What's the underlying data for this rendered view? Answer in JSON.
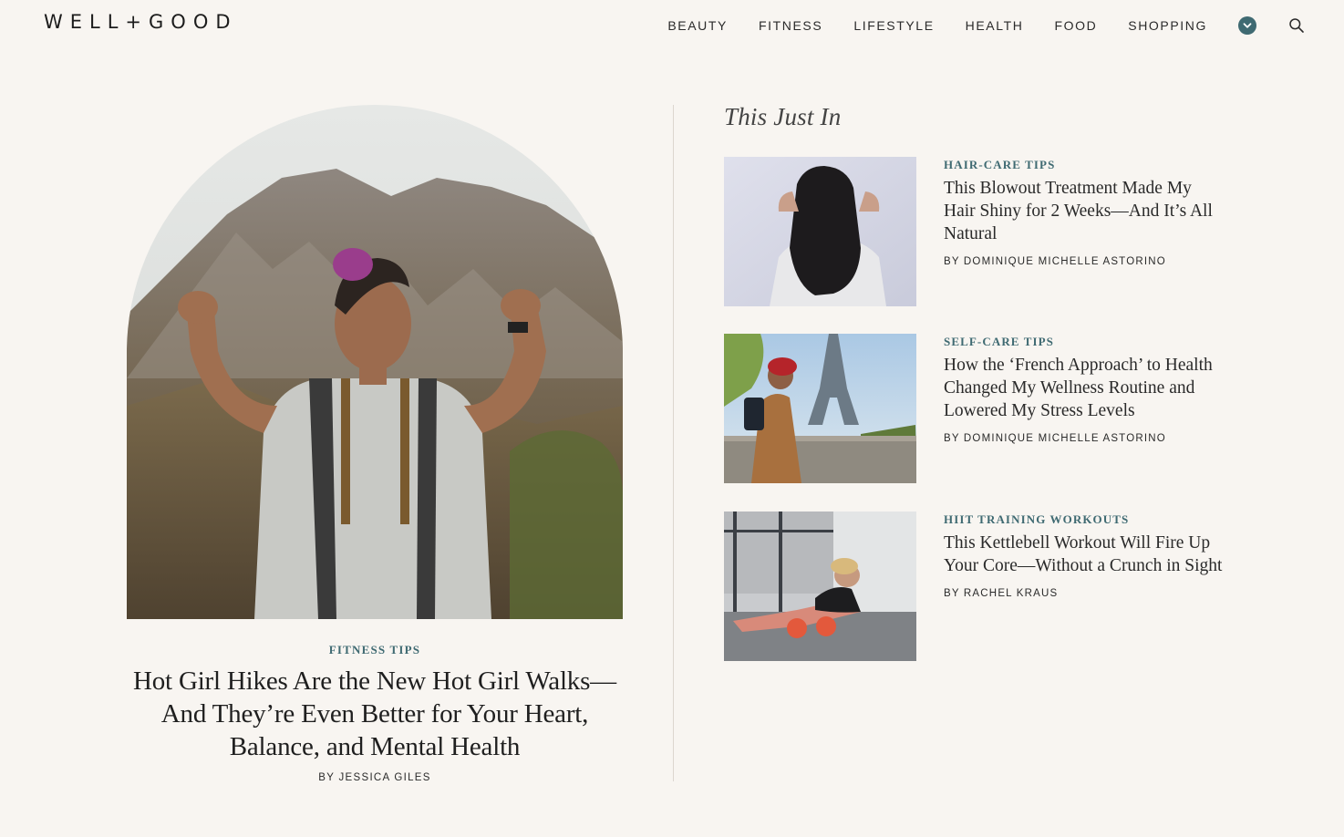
{
  "header": {
    "logo": "WELL+GOOD",
    "nav": [
      "BEAUTY",
      "FITNESS",
      "LIFESTYLE",
      "HEALTH",
      "FOOD",
      "SHOPPING"
    ],
    "more_icon": "chevron-down-icon",
    "search_icon": "search-icon"
  },
  "colors": {
    "background": "#f8f5f1",
    "accent": "#3f6a72",
    "text": "#222222"
  },
  "feature": {
    "category": "FITNESS TIPS",
    "title": "Hot Girl Hikes Are the New Hot Girl Walks—And They’re Even Better for Your Heart, Balance, and Mental Health",
    "author": "BY JESSICA GILES",
    "image": "woman flexing on mountain hike"
  },
  "just_in": {
    "heading": "This Just In",
    "articles": [
      {
        "category": "HAIR-CARE TIPS",
        "title": "This Blowout Treatment Made My Hair Shiny for 2 Weeks—And It’s All Natural",
        "author": "BY DOMINIQUE MICHELLE ASTORINO",
        "image": "woman with long dark shiny hair"
      },
      {
        "category": "SELF-CARE TIPS",
        "title": "How the ‘French Approach’ to Health Changed My Wellness Routine and Lowered My Stress Levels",
        "author": "BY DOMINIQUE MICHELLE ASTORINO",
        "image": "woman near Eiffel Tower"
      },
      {
        "category": "HIIT TRAINING WORKOUTS",
        "title": "This Kettlebell Workout Will Fire Up Your Core—Without a Crunch in Sight",
        "author": "BY RACHEL KRAUS",
        "image": "woman doing kettlebell plank in gym"
      }
    ]
  }
}
